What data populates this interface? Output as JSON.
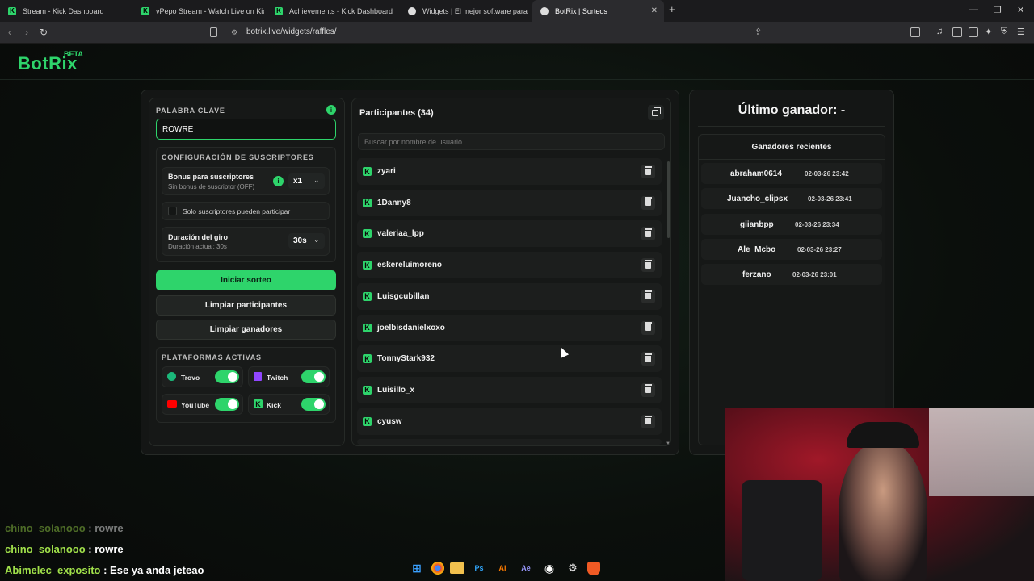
{
  "browser": {
    "tabs": [
      {
        "title": "Stream - Kick Dashboard",
        "favicon": "kick-icon"
      },
      {
        "title": "vPepo Stream - Watch Live on Kick",
        "favicon": "kick-icon"
      },
      {
        "title": "Achievements - Kick Dashboard",
        "favicon": "kick-icon"
      },
      {
        "title": "Widgets | El mejor software para pot",
        "favicon": "botrix-icon"
      },
      {
        "title": "BotRix | Sorteos",
        "favicon": "botrix-icon",
        "active": true
      }
    ],
    "new_tab": "+",
    "url": "botrix.live/widgets/raffles/"
  },
  "brand": {
    "name": "BotRix",
    "badge": "BETA",
    "accent": "#2ed46b"
  },
  "settings": {
    "keyword_label": "PALABRA CLAVE",
    "keyword_value": "ROWRE",
    "subs_section": "CONFIGURACIÓN DE SUSCRIPTORES",
    "bonus_title": "Bonus para suscriptores",
    "bonus_sub": "Sin bonus de suscriptor (OFF)",
    "bonus_value": "x1",
    "subs_only": "Solo suscriptores pueden participar",
    "spin_title": "Duración del giro",
    "spin_sub": "Duración actual: 30s",
    "spin_value": "30s",
    "start_button": "Iniciar sorteo",
    "clear_participants": "Limpiar participantes",
    "clear_winners": "Limpiar ganadores",
    "platforms_label": "PLATAFORMAS ACTIVAS",
    "platforms": [
      {
        "name": "Trovo",
        "on": true
      },
      {
        "name": "Twitch",
        "on": true
      },
      {
        "name": "YouTube",
        "on": true
      },
      {
        "name": "Kick",
        "on": true
      }
    ]
  },
  "participants": {
    "title": "Participantes (34)",
    "search_placeholder": "Buscar por nombre de usuario...",
    "list": [
      "zyari",
      "1Danny8",
      "valeriaa_lpp",
      "eskereluimoreno",
      "Luisgcubillan",
      "joelbisdanielxoxo",
      "TonnyStark932",
      "Luisillo_x",
      "cyusw"
    ]
  },
  "winners": {
    "last_winner": "Último ganador: -",
    "recent_title": "Ganadores recientes",
    "list": [
      {
        "name": "abraham0614",
        "date": "02-03-26 23:42"
      },
      {
        "name": "Juancho_clipsx",
        "date": "02-03-26 23:41"
      },
      {
        "name": "giianbpp",
        "date": "02-03-26 23:34"
      },
      {
        "name": "Ale_Mcbo",
        "date": "02-03-26 23:27"
      },
      {
        "name": "ferzano",
        "date": "02-03-26 23:01"
      }
    ]
  },
  "chat": [
    {
      "user": "chino_solanooo",
      "msg": " : rowre",
      "faded": true
    },
    {
      "user": "chino_solanooo",
      "msg": " : rowre"
    },
    {
      "user": "Abimelec_exposito",
      "msg": " : Ese ya anda jeteao"
    }
  ]
}
